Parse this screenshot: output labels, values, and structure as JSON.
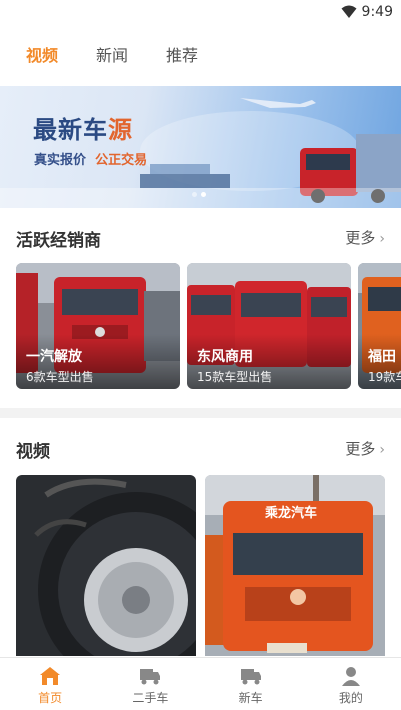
{
  "status_bar": {
    "time": "9:49"
  },
  "top_tabs": [
    {
      "label": "视频"
    },
    {
      "label": "新闻"
    },
    {
      "label": "推荐"
    }
  ],
  "banner": {
    "title_main": "最新车",
    "title_accent": "源",
    "sub_1": "真实报价",
    "sub_2": "公正交易"
  },
  "dealers_section": {
    "title": "活跃经销商",
    "more": "更多",
    "items": [
      {
        "name": "一汽解放",
        "count": "6款车型出售"
      },
      {
        "name": "东风商用",
        "count": "15款车型出售"
      },
      {
        "name": "福田",
        "count": "19款车"
      }
    ]
  },
  "videos_section": {
    "title": "视频",
    "more": "更多",
    "truck_brand_text": "乘龙汽车"
  },
  "bottom_nav": [
    {
      "label": "首页"
    },
    {
      "label": "二手车"
    },
    {
      "label": "新车"
    },
    {
      "label": "我的"
    }
  ],
  "colors": {
    "accent": "#f28a2a",
    "truck_red": "#c8232a",
    "truck_orange": "#e4551f"
  }
}
